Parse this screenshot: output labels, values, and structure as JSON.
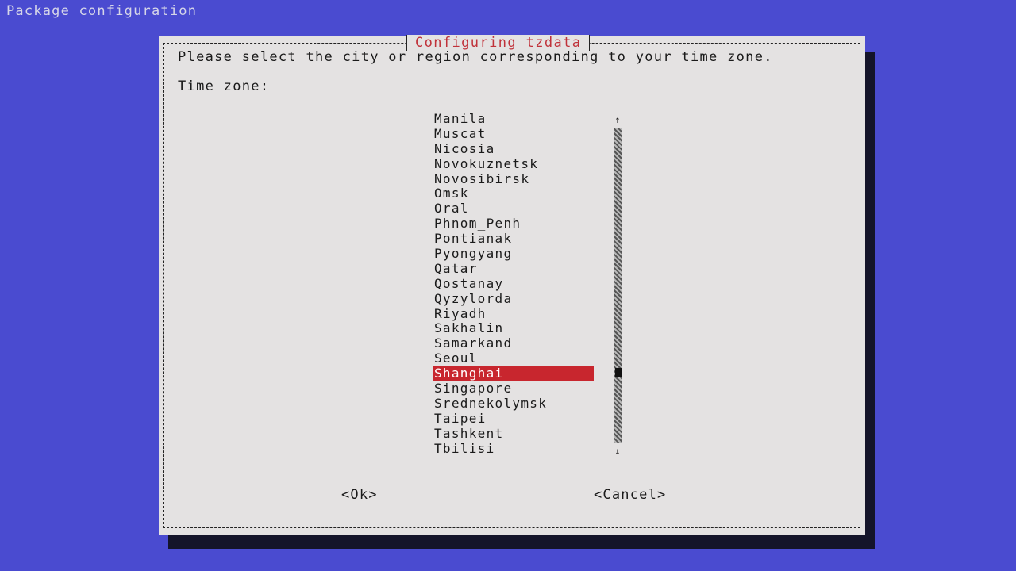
{
  "screen": {
    "title": "Package configuration"
  },
  "dialog": {
    "title": "Configuring tzdata",
    "prompt": "Please select the city or region corresponding to your time zone.",
    "label": "Time zone:",
    "items": [
      "Manila",
      "Muscat",
      "Nicosia",
      "Novokuznetsk",
      "Novosibirsk",
      "Omsk",
      "Oral",
      "Phnom_Penh",
      "Pontianak",
      "Pyongyang",
      "Qatar",
      "Qostanay",
      "Qyzylorda",
      "Riyadh",
      "Sakhalin",
      "Samarkand",
      "Seoul",
      "Shanghai",
      "Singapore",
      "Srednekolymsk",
      "Taipei",
      "Tashkent",
      "Tbilisi"
    ],
    "selected": "Shanghai",
    "scroll_up_icon": "↑",
    "scroll_down_icon": "↓",
    "buttons": {
      "ok": "<Ok>",
      "cancel": "<Cancel>"
    }
  },
  "colors": {
    "background": "#4a4bd0",
    "dialog": "#e4e2e2",
    "accent": "#c8262e"
  }
}
